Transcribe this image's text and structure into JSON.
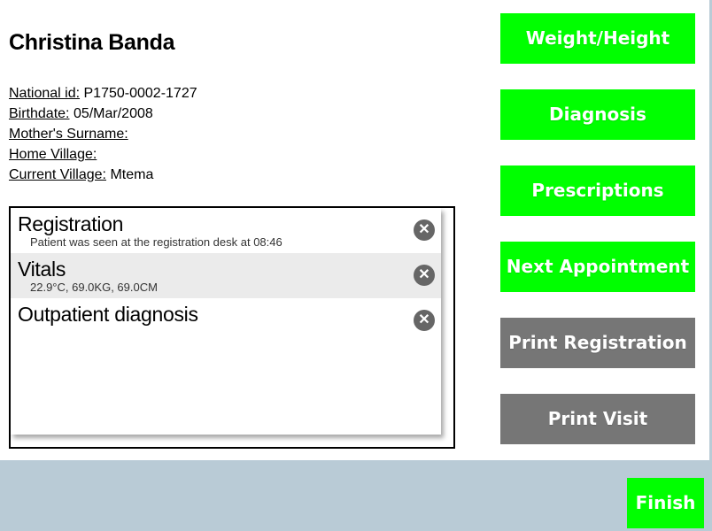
{
  "patient": {
    "name": "Christina Banda",
    "national_id_label": "National id:",
    "national_id": "P1750-0002-1727",
    "birthdate_label": "Birthdate:",
    "birthdate": "05/Mar/2008",
    "mothers_surname_label": "Mother's Surname:",
    "mothers_surname": "",
    "home_village_label": "Home Village:",
    "home_village": "",
    "current_village_label": "Current Village:",
    "current_village": "Mtema"
  },
  "encounters": [
    {
      "title": "Registration",
      "detail": "Patient was seen at the registration desk at 08:46"
    },
    {
      "title": "Vitals",
      "detail": "22.9°C, 69.0KG, 69.0CM"
    },
    {
      "title": "Outpatient diagnosis",
      "detail": ""
    }
  ],
  "actions": {
    "weight_height": "Weight/Height",
    "diagnosis": "Diagnosis",
    "prescriptions": "Prescriptions",
    "next_appointment": "Next Appointment",
    "print_registration": "Print Registration",
    "print_visit": "Print Visit"
  },
  "footer": {
    "finish": "Finish"
  },
  "icons": {
    "remove": "circle-x-icon"
  },
  "colors": {
    "active_button": "#00ff00",
    "inactive_button": "#767676",
    "footer_bg": "#b9cbd6",
    "row_alt": "#ebebeb"
  }
}
